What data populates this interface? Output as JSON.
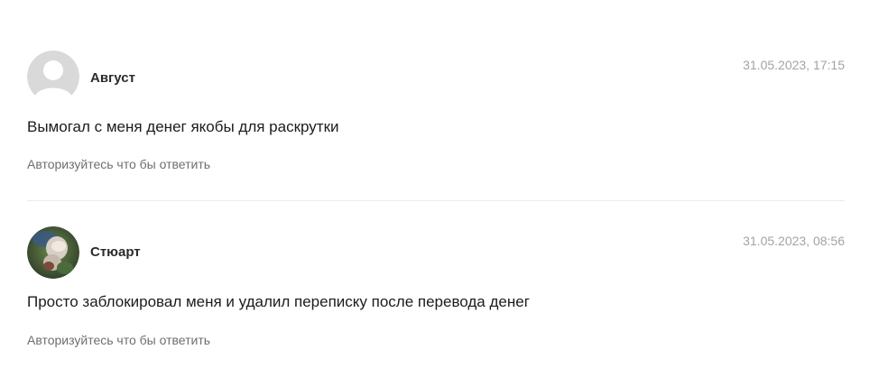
{
  "comments": [
    {
      "author": "Август",
      "date": "31.05.2023, 17:15",
      "text": "Вымогал с меня денег якобы для раскрутки",
      "reply_label": "Авторизуйтесь что бы ответить",
      "avatar_icon": "default-user-icon"
    },
    {
      "author": "Стюарт",
      "date": "31.05.2023, 08:56",
      "text": "Просто заблокировал меня и удалил переписку после перевода денег",
      "reply_label": "Авторизуйтесь что бы ответить",
      "avatar_icon": "user-photo-avatar"
    }
  ],
  "colors": {
    "date": "#a3a3a3",
    "reply": "#6f6f6f",
    "divider": "#ececec",
    "default_avatar": "#d9d9d9"
  }
}
